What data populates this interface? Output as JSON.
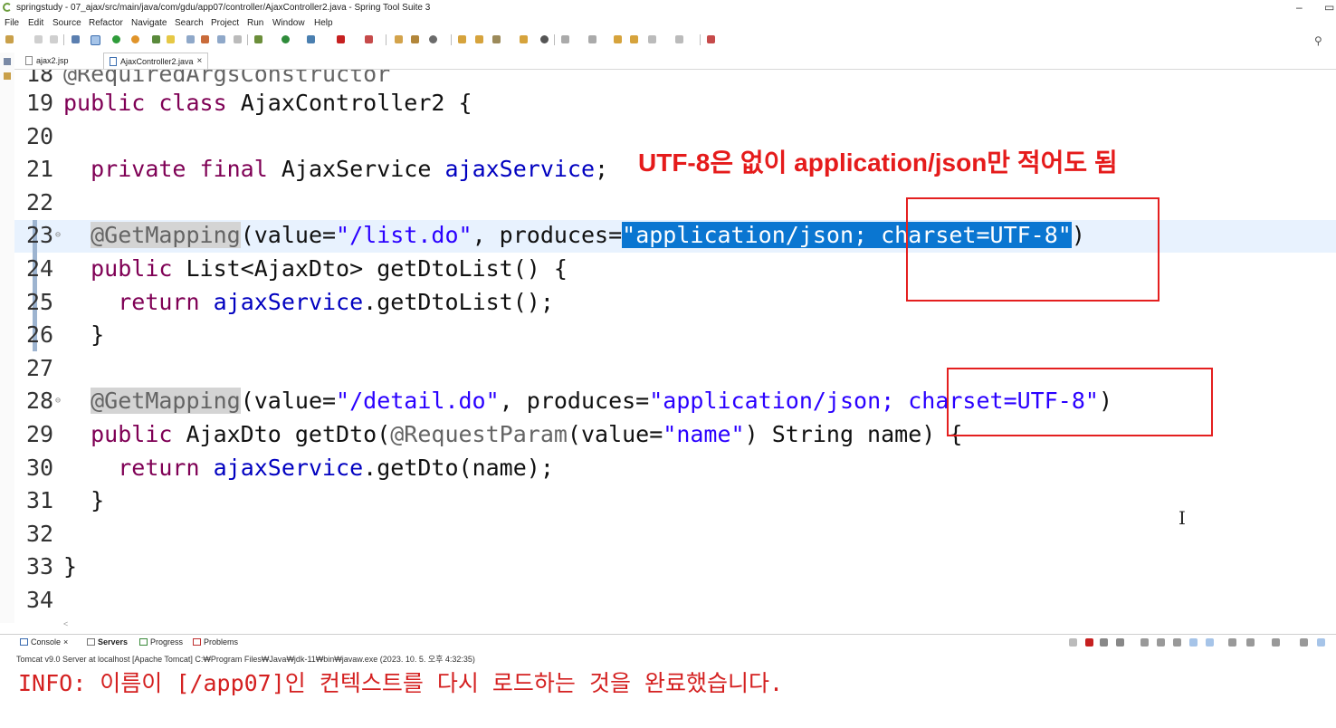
{
  "window": {
    "title": "springstudy - 07_ajax/src/main/java/com/gdu/app07/controller/AjaxController2.java - Spring Tool Suite 3",
    "minimize": "–",
    "restore": "▭"
  },
  "menu": [
    "File",
    "Edit",
    "Source",
    "Refactor",
    "Navigate",
    "Search",
    "Project",
    "Run",
    "Window",
    "Help"
  ],
  "toolbar": {
    "search_icon": "search-icon"
  },
  "tabs": [
    {
      "label": "ajax2.jsp",
      "active": false
    },
    {
      "label": "AjaxController2.java",
      "active": true,
      "close": "×"
    }
  ],
  "editor": {
    "partial_line": {
      "num": "18",
      "text": "@RequiredArgsConstructor"
    },
    "lines": [
      {
        "num": "19",
        "segments": [
          {
            "t": "kw",
            "v": "public"
          },
          {
            "t": "p",
            "v": " "
          },
          {
            "t": "kw",
            "v": "class"
          },
          {
            "t": "p",
            "v": " AjaxController2 {"
          }
        ]
      },
      {
        "num": "20",
        "segments": []
      },
      {
        "num": "21",
        "segments": [
          {
            "t": "p",
            "v": "  "
          },
          {
            "t": "kw",
            "v": "private"
          },
          {
            "t": "p",
            "v": " "
          },
          {
            "t": "kw",
            "v": "final"
          },
          {
            "t": "p",
            "v": " AjaxService "
          },
          {
            "t": "fld",
            "v": "ajaxService"
          },
          {
            "t": "p",
            "v": ";"
          }
        ]
      },
      {
        "num": "22",
        "segments": []
      },
      {
        "num": "23",
        "fold": "⊖",
        "current": true,
        "segments": [
          {
            "t": "p",
            "v": "  "
          },
          {
            "t": "annhl",
            "v": "@GetMapping"
          },
          {
            "t": "p",
            "v": "(value="
          },
          {
            "t": "str",
            "v": "\"/list.do\""
          },
          {
            "t": "p",
            "v": ", produces="
          },
          {
            "t": "sel",
            "v": "\"application/json; charset=UTF-8\""
          },
          {
            "t": "p",
            "v": ")"
          }
        ]
      },
      {
        "num": "24",
        "segments": [
          {
            "t": "p",
            "v": "  "
          },
          {
            "t": "kw",
            "v": "public"
          },
          {
            "t": "p",
            "v": " List<AjaxDto> getDtoList() {"
          }
        ]
      },
      {
        "num": "25",
        "segments": [
          {
            "t": "p",
            "v": "    "
          },
          {
            "t": "kw",
            "v": "return"
          },
          {
            "t": "p",
            "v": " "
          },
          {
            "t": "fld",
            "v": "ajaxService"
          },
          {
            "t": "p",
            "v": ".getDtoList();"
          }
        ]
      },
      {
        "num": "26",
        "segments": [
          {
            "t": "p",
            "v": "  }"
          }
        ]
      },
      {
        "num": "27",
        "segments": []
      },
      {
        "num": "28",
        "fold": "⊖",
        "segments": [
          {
            "t": "p",
            "v": "  "
          },
          {
            "t": "annhl",
            "v": "@GetMapping"
          },
          {
            "t": "p",
            "v": "(value="
          },
          {
            "t": "str",
            "v": "\"/detail.do\""
          },
          {
            "t": "p",
            "v": ", produces="
          },
          {
            "t": "str",
            "v": "\"application/json; charset=UTF-8\""
          },
          {
            "t": "p",
            "v": ")"
          }
        ]
      },
      {
        "num": "29",
        "segments": [
          {
            "t": "p",
            "v": "  "
          },
          {
            "t": "kw",
            "v": "public"
          },
          {
            "t": "p",
            "v": " AjaxDto getDto("
          },
          {
            "t": "ann",
            "v": "@RequestParam"
          },
          {
            "t": "p",
            "v": "(value="
          },
          {
            "t": "str",
            "v": "\"name\""
          },
          {
            "t": "p",
            "v": ") String name) {"
          }
        ]
      },
      {
        "num": "30",
        "segments": [
          {
            "t": "p",
            "v": "    "
          },
          {
            "t": "kw",
            "v": "return"
          },
          {
            "t": "p",
            "v": " "
          },
          {
            "t": "fld",
            "v": "ajaxService"
          },
          {
            "t": "p",
            "v": ".getDto(name);"
          }
        ]
      },
      {
        "num": "31",
        "segments": [
          {
            "t": "p",
            "v": "  }"
          }
        ]
      },
      {
        "num": "32",
        "segments": []
      },
      {
        "num": "33",
        "segments": [
          {
            "t": "p",
            "v": "}"
          }
        ]
      },
      {
        "num": "34",
        "segments": []
      }
    ],
    "annotation_note": "UTF-8은 없이 application/json만 적어도 됨",
    "cursor_glyph": "I",
    "hscroll_glyph": "<"
  },
  "console": {
    "tabs": [
      {
        "label": "Console",
        "close": "×",
        "bold": false
      },
      {
        "label": "Servers",
        "bold": true
      },
      {
        "label": "Progress",
        "bold": false
      },
      {
        "label": "Problems",
        "bold": false
      }
    ],
    "subtitle": "Tomcat v9.0 Server at localhost [Apache Tomcat] C:₩Program Files₩Java₩jdk-11₩bin₩javaw.exe  (2023. 10. 5. 오후 4:32:35)",
    "output": "INFO: 이름이 [/app07]인 컨텍스트를 다시 로드하는 것을 완료했습니다."
  },
  "colors": {
    "keyword": "#7f0055",
    "field": "#0000c0",
    "string": "#2a00ff",
    "annotation": "#646464",
    "selection": "#0a76d1",
    "current_line": "#e8f2fe",
    "note_red": "#e51b1b",
    "console_output": "#d42020"
  }
}
